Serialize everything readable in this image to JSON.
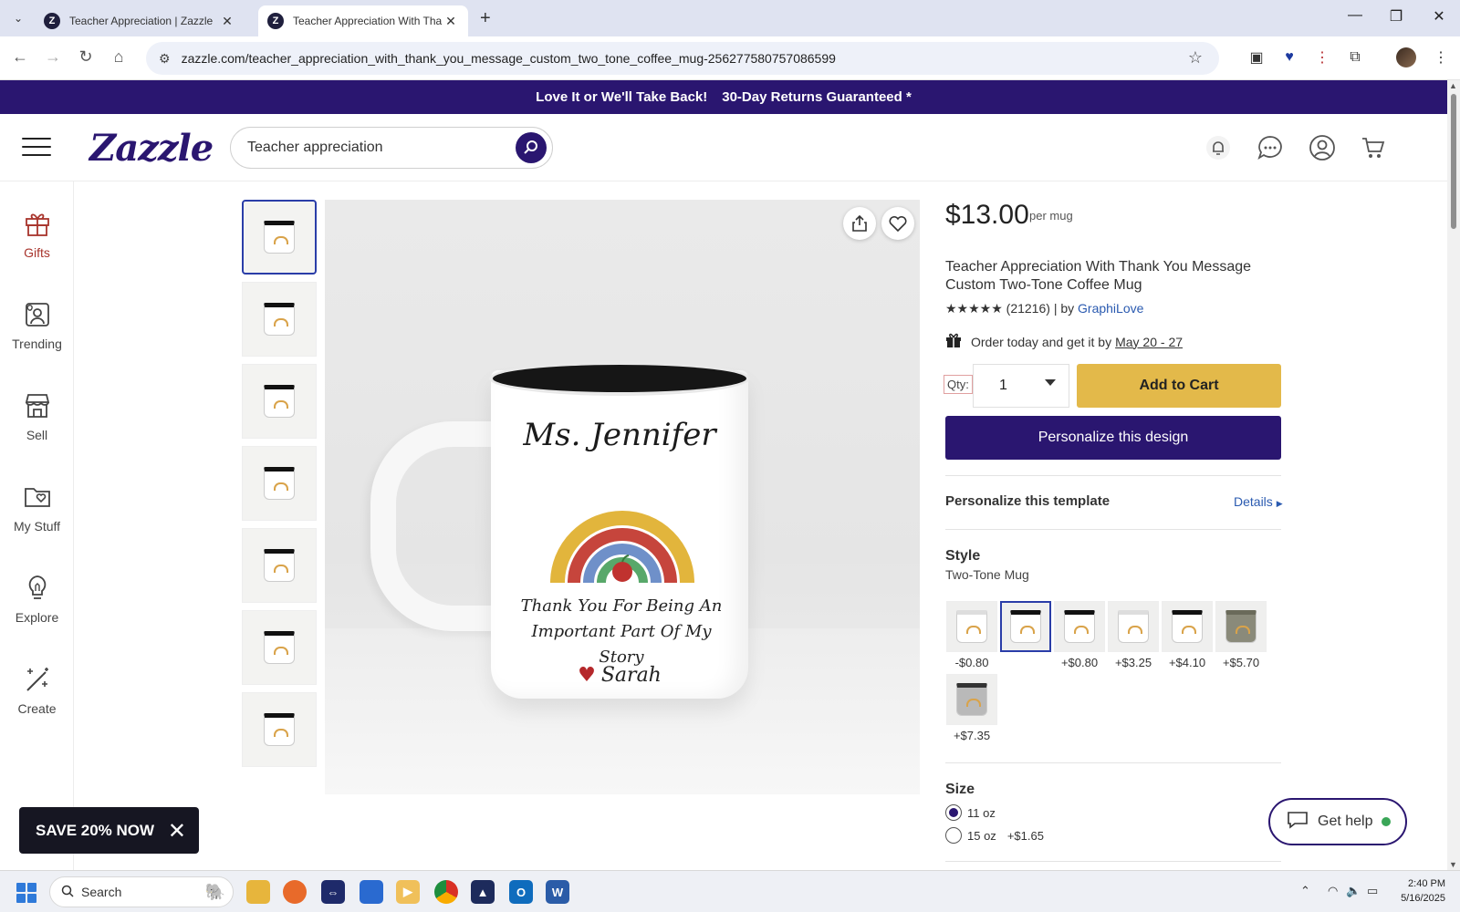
{
  "browser": {
    "tabs": [
      {
        "title": "Teacher Appreciation | Zazzle",
        "active": false
      },
      {
        "title": "Teacher Appreciation With Thank Y",
        "active": true
      }
    ],
    "url": "zazzle.com/teacher_appreciation_with_thank_you_message_custom_two_tone_coffee_mug-256277580757086599"
  },
  "promo": {
    "left": "Love It or We'll Take Back!",
    "right": "30-Day Returns Guaranteed *"
  },
  "header": {
    "logo": "Zazzle",
    "search_value": "Teacher appreciation"
  },
  "sidenav": [
    {
      "label": "Gifts",
      "icon": "gift-icon"
    },
    {
      "label": "Trending",
      "icon": "trending-icon"
    },
    {
      "label": "Sell",
      "icon": "store-icon"
    },
    {
      "label": "My Stuff",
      "icon": "folder-heart-icon"
    },
    {
      "label": "Explore",
      "icon": "lightbulb-icon"
    },
    {
      "label": "Create",
      "icon": "magic-wand-icon"
    }
  ],
  "mug": {
    "name": "Ms. Jennifer",
    "message_line1": "Thank You For Being An",
    "message_line2": "Important Part Of My Story",
    "signature": "Sarah"
  },
  "product": {
    "price": "$13.00",
    "unit": "per mug",
    "title": "Teacher Appreciation With Thank You Message Custom Two-Tone Coffee Mug",
    "stars": "★★★★★",
    "review_count": "(21216)",
    "by_label": "| by",
    "seller": "GraphiLove",
    "delivery_text": "Order today and get it by",
    "delivery_date": "May 20 - 27",
    "qty_label": "Qty:",
    "qty_value": "1",
    "add_to_cart": "Add to Cart",
    "personalize_button": "Personalize this design",
    "template_title": "Personalize this template",
    "details_link": "Details",
    "style_title": "Style",
    "style_value": "Two-Tone Mug",
    "style_prices": [
      "-$0.80",
      "",
      "+$0.80",
      "+$3.25",
      "+$4.10",
      "+$5.70",
      "+$7.35"
    ],
    "size_title": "Size",
    "sizes": [
      {
        "label": "11 oz",
        "extra": "",
        "selected": true
      },
      {
        "label": "15 oz",
        "extra": "+$1.65",
        "selected": false
      }
    ]
  },
  "overlays": {
    "save_banner": "SAVE 20% NOW",
    "get_help": "Get help"
  },
  "taskbar": {
    "search": "Search",
    "time": "2:40 PM",
    "date": "5/16/2025"
  },
  "colors": {
    "brand": "#2a1670",
    "cart_button": "#e3b94a",
    "accent_link": "#2a5ab0",
    "active_nav": "#a8342c"
  }
}
